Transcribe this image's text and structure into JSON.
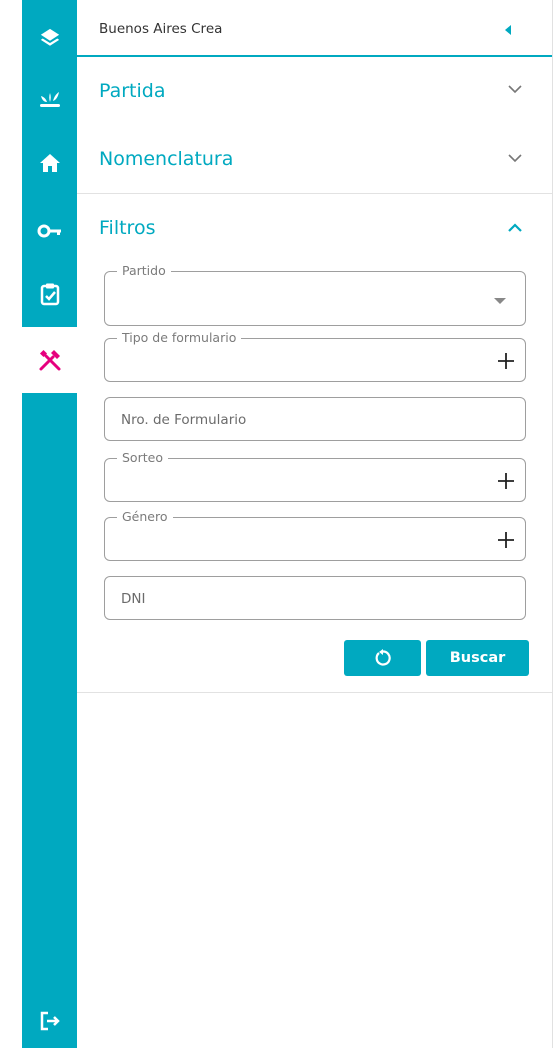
{
  "header": {
    "title": "Buenos Aires Crea"
  },
  "sections": {
    "partida": "Partida",
    "nomenclatura": "Nomenclatura",
    "filtros": "Filtros"
  },
  "form": {
    "partido_label": "Partido",
    "tipo_formulario_label": "Tipo de formulario",
    "nro_formulario_placeholder": "Nro. de Formulario",
    "sorteo_label": "Sorteo",
    "genero_label": "Género",
    "dni_placeholder": "DNI"
  },
  "actions": {
    "search_label": "Buscar"
  },
  "sidebar": {
    "items": [
      {
        "icon": "layers-icon"
      },
      {
        "icon": "sprout-icon"
      },
      {
        "icon": "home-icon"
      },
      {
        "icon": "key-icon"
      },
      {
        "icon": "clipboard-check-icon"
      },
      {
        "icon": "tools-icon",
        "active": true
      }
    ],
    "bottom": {
      "icon": "logout-icon"
    }
  },
  "colors": {
    "accent": "#00a9c0",
    "active_icon": "#e6007e",
    "sidebar_bg": "#00a9c0"
  }
}
